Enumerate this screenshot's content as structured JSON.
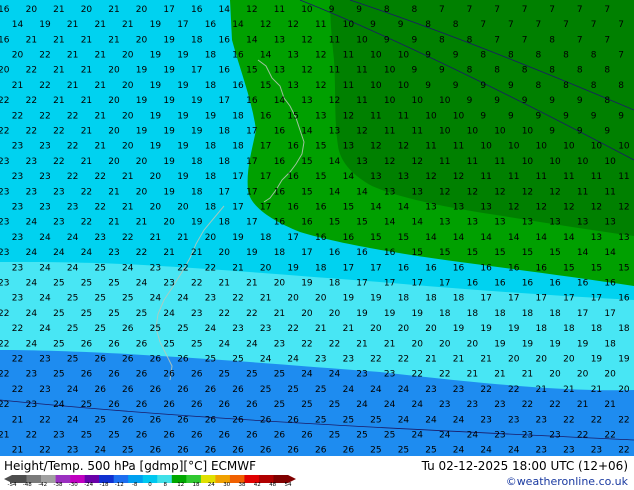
{
  "footer": {
    "title": "Height/Temp. 500 hPa [gdmp][°C] ECMWF",
    "datetime": "Tu 02-12-2025 18:00 UTC (12+06)",
    "credit": "©weatheronline.co.uk"
  },
  "legend": {
    "ticks": [
      "-54",
      "-48",
      "-42",
      "-38",
      "-30",
      "-24",
      "-18",
      "-12",
      "-8",
      "0",
      "8",
      "12",
      "18",
      "24",
      "30",
      "38",
      "42",
      "48",
      "54"
    ],
    "colors": [
      "#4d4d4d",
      "#7a7a7a",
      "#a0a0a0",
      "#9b30c0",
      "#c000c0",
      "#6a00a8",
      "#1030d0",
      "#1e6ef0",
      "#00a0f0",
      "#00c8f0",
      "#40e0e8",
      "#00a800",
      "#30c830",
      "#e0e000",
      "#f0a000",
      "#f06000",
      "#e00000",
      "#b00000",
      "#800000"
    ]
  },
  "map": {
    "zones": {
      "dark_green": "#008000",
      "green": "#00a000",
      "cyan": "#00d2f0",
      "light_cyan": "#48e6f4",
      "blue": "#1e8cf0"
    },
    "temperature_rows": [
      "16 20 21 20 21 20 17 16 14 12 11 10 9 9 8 8 7 7 7 7 7 7 7",
      "14 19 21 21 21 19 17 16 14 12 12 11 10 9 9 8 8 7 7 7 7 7 7",
      "16 21 21 21 21 20 19 18 16 14 13 12 11 10 9 9 8 8 7 7 8 7 7",
      "20 22 21 21 20 19 19 18 16 14 13 12 11 10 10 9 9 8 8 8 8 8 7",
      "20 22 21 21 20 19 19 17 16 15 13 12 11 11 10 9 9 8 8 8 8 8 8",
      "21 22 21 21 20 19 19 18 16 15 13 12 11 10 10 9 9 9 9 8 8 8 8",
      "22 22 21 21 20 19 19 19 17 16 14 13 12 11 10 10 10 9 9 9 9 9 8",
      "22 22 22 21 20 19 19 19 18 16 15 13 12 11 11 10 10 9 9 9 9 9 9",
      "22 22 22 21 20 19 19 19 18 17 16 14 13 12 11 11 10 10 10 10 9 9 9",
      "23 23 22 21 20 19 19 18 18 17 16 15 13 12 12 11 11 10 10 10 10 10 10",
      "23 23 22 21 20 20 19 18 18 17 16 15 14 13 12 12 11 11 11 10 10 10 10",
      "23 23 22 22 21 20 19 18 17 17 16 15 14 13 13 12 12 11 11 11 11 11 11",
      "23 23 23 22 21 20 19 18 17 17 16 15 14 14 13 13 12 12 12 12 12 11 11",
      "23 23 23 22 21 20 20 18 17 17 16 16 15 14 14 13 13 13 12 12 12 12 12",
      "23 24 23 22 21 21 20 19 18 17 16 16 15 15 14 14 13 13 13 13 13 13 13",
      "23 24 24 23 22 21 21 20 19 18 17 16 16 15 15 14 14 14 14 14 14 13 13",
      "23 24 24 24 23 22 21 21 20 19 18 17 16 16 16 15 15 15 15 15 15 14 14",
      "23 24 24 25 24 23 22 22 21 20 19 18 17 17 16 16 16 16 16 16 15 15 15",
      "23 24 25 25 25 24 23 22 21 21 20 19 18 17 17 17 17 16 16 16 16 16 16",
      "23 24 25 25 25 24 24 23 22 21 20 20 19 19 18 18 18 17 17 17 17 17 16",
      "22 24 25 25 25 25 24 23 22 22 21 20 20 19 19 19 18 18 18 18 18 17 17",
      "22 24 25 25 26 25 25 24 23 23 22 21 21 20 20 20 19 19 19 18 18 18 18",
      "22 24 25 26 26 26 25 25 24 24 23 22 22 21 21 20 20 20 19 19 19 19 18",
      "22 23 25 26 26 26 26 25 25 24 24 23 23 22 22 21 21 21 20 20 20 19 19",
      "22 23 25 26 26 26 26 26 25 25 25 24 24 23 23 22 22 21 21 21 20 20 20",
      "22 23 24 26 26 26 26 26 26 25 25 25 24 24 24 23 23 22 22 21 21 21 20",
      "22 23 24 25 26 26 26 26 26 26 25 25 25 24 24 24 23 23 23 22 22 21 21",
      "21 22 24 25 26 26 26 26 26 26 26 25 25 25 24 24 24 23 23 23 22 22 22",
      "21 22 23 25 25 26 26 26 26 26 26 26 25 25 25 24 24 24 23 23 23 22 22",
      "21 22 23 24 25 26 26 26 26 26 26 26 26 25 25 25 24 24 24 23 23 23 22"
    ]
  }
}
